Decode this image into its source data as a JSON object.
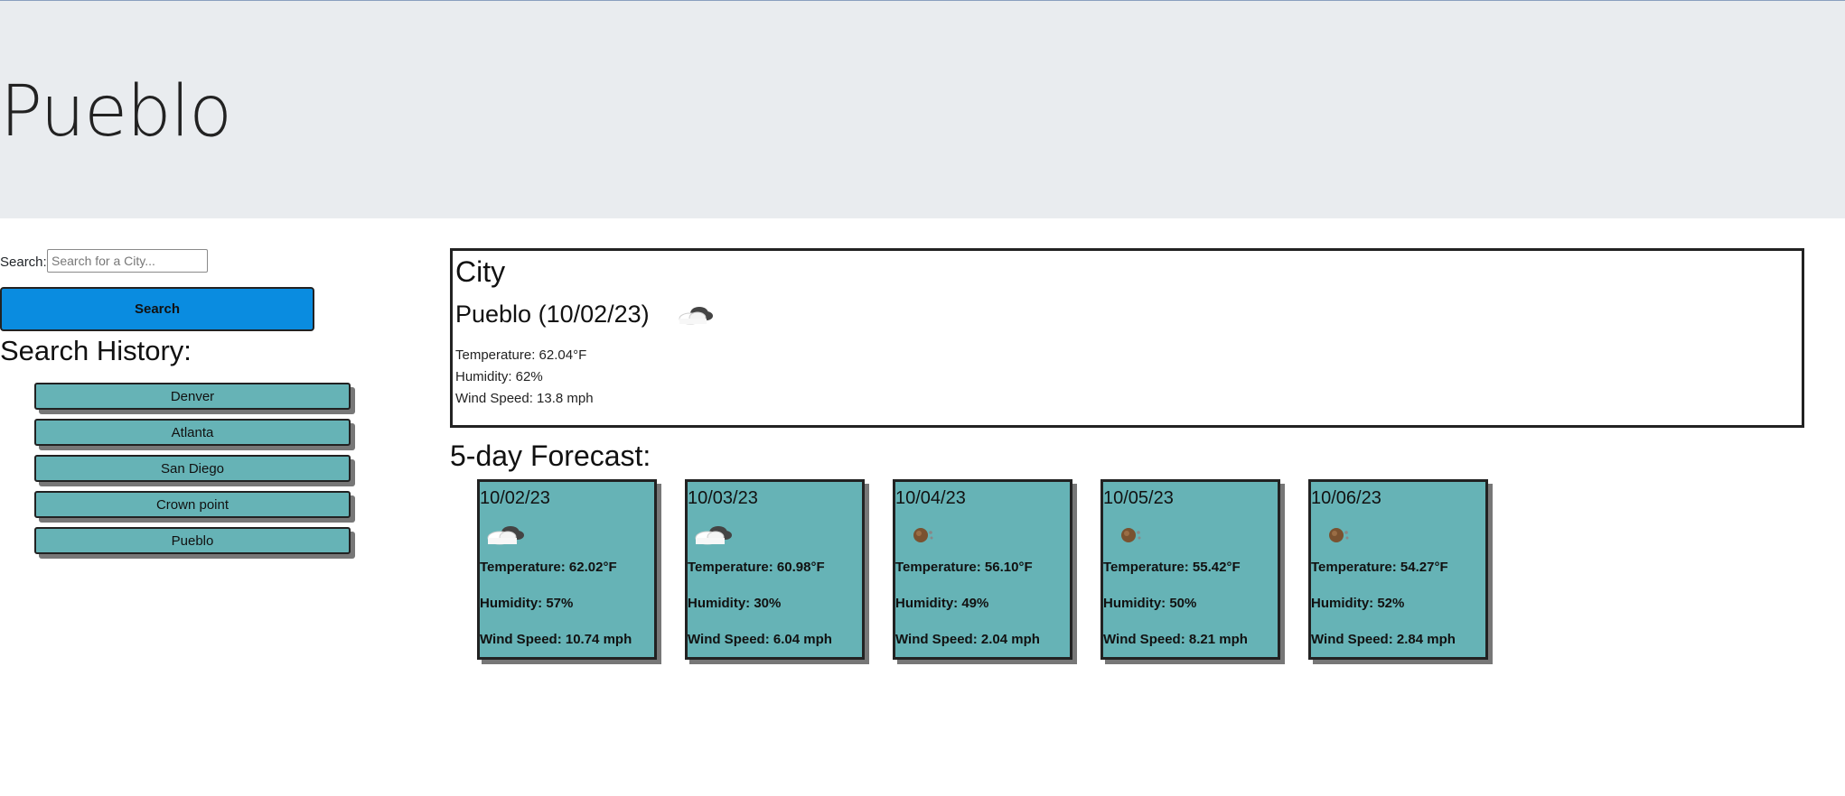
{
  "header": {
    "title": "Pueblo"
  },
  "search": {
    "label": "Search:",
    "placeholder": "Search for a City...",
    "value": "",
    "button_label": "Search"
  },
  "history": {
    "title": "Search History:",
    "items": [
      "Denver",
      "Atlanta",
      "San Diego",
      "Crown point",
      "Pueblo"
    ]
  },
  "current": {
    "heading": "City",
    "city_date": "Pueblo (10/02/23)",
    "icon": "cloudy-icon",
    "temperature": "Temperature: 62.04°F",
    "humidity": "Humidity: 62%",
    "wind": "Wind Speed: 13.8 mph"
  },
  "forecast": {
    "title": "5-day Forecast:",
    "days": [
      {
        "date": "10/02/23",
        "icon": "cloudy-icon",
        "temperature": "Temperature: 62.02°F",
        "humidity": "Humidity: 57%",
        "wind": "Wind Speed: 10.74 mph"
      },
      {
        "date": "10/03/23",
        "icon": "cloudy-icon",
        "temperature": "Temperature: 60.98°F",
        "humidity": "Humidity: 30%",
        "wind": "Wind Speed: 6.04 mph"
      },
      {
        "date": "10/04/23",
        "icon": "clear-sky-icon",
        "temperature": "Temperature: 56.10°F",
        "humidity": "Humidity: 49%",
        "wind": "Wind Speed: 2.04 mph"
      },
      {
        "date": "10/05/23",
        "icon": "clear-sky-icon",
        "temperature": "Temperature: 55.42°F",
        "humidity": "Humidity: 50%",
        "wind": "Wind Speed: 8.21 mph"
      },
      {
        "date": "10/06/23",
        "icon": "clear-sky-icon",
        "temperature": "Temperature: 54.27°F",
        "humidity": "Humidity: 52%",
        "wind": "Wind Speed: 2.84 mph"
      }
    ]
  },
  "colors": {
    "header_bg": "#e9ecef",
    "search_button": "#0a8ce0",
    "card_bg": "#66b3b6"
  }
}
